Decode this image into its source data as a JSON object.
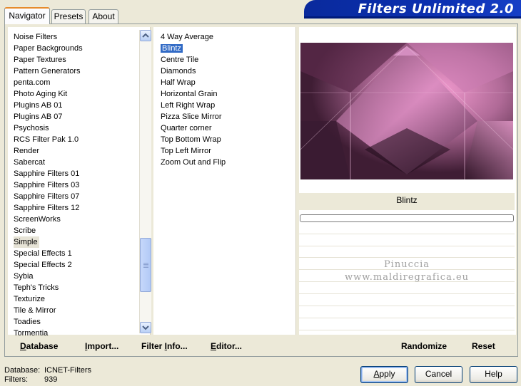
{
  "tabs": [
    {
      "label": "Navigator",
      "active": true
    },
    {
      "label": "Presets",
      "active": false
    },
    {
      "label": "About",
      "active": false
    }
  ],
  "brand": {
    "title": "Filters Unlimited 2.0"
  },
  "categories": {
    "items": [
      "Noise Filters",
      "Paper Backgrounds",
      "Paper Textures",
      "Pattern Generators",
      "penta.com",
      "Photo Aging Kit",
      "Plugins AB 01",
      "Plugins AB 07",
      "Psychosis",
      "RCS Filter Pak 1.0",
      "Render",
      "Sabercat",
      "Sapphire Filters 01",
      "Sapphire Filters 03",
      "Sapphire Filters 07",
      "Sapphire Filters 12",
      "ScreenWorks",
      "Scribe",
      "Simple",
      "Special Effects 1",
      "Special Effects 2",
      "Sybia",
      "Teph's Tricks",
      "Texturize",
      "Tile & Mirror",
      "Toadies",
      "Tormentia"
    ],
    "selected": "Simple"
  },
  "filters": {
    "items": [
      "4 Way Average",
      "Blintz",
      "Centre Tile",
      "Diamonds",
      "Half Wrap",
      "Horizontal Grain",
      "Left Right Wrap",
      "Pizza Slice Mirror",
      "Quarter corner",
      "Top Bottom Wrap",
      "Top Left Mirror",
      "Zoom Out and Flip"
    ],
    "selected": "Blintz"
  },
  "preview": {
    "filter_name": "Blintz",
    "watermark_line1": "Pinuccia",
    "watermark_line2": "www.maldiregrafica.eu"
  },
  "bottom_buttons": {
    "database": {
      "accel": "D",
      "rest": "atabase"
    },
    "import": {
      "accel": "I",
      "rest": "mport..."
    },
    "filter_info": {
      "pre": "Filter ",
      "accel": "I",
      "rest": "nfo..."
    },
    "editor": {
      "accel": "E",
      "rest": "ditor..."
    },
    "randomize": "Randomize",
    "reset": "Reset"
  },
  "status": {
    "database_label": "Database:",
    "database_value": "ICNET-Filters",
    "filters_label": "Filters:",
    "filters_value": "939"
  },
  "dialog_buttons": {
    "apply": {
      "accel": "A",
      "rest": "pply"
    },
    "cancel": "Cancel",
    "help": "Help"
  },
  "colors": {
    "accent": "#316ac5",
    "brand_bg": "#0b2fb0",
    "preview_pink": "#e68ac3"
  },
  "icons": {
    "scroll_up": "chevron-up-icon",
    "scroll_down": "chevron-down-icon"
  }
}
